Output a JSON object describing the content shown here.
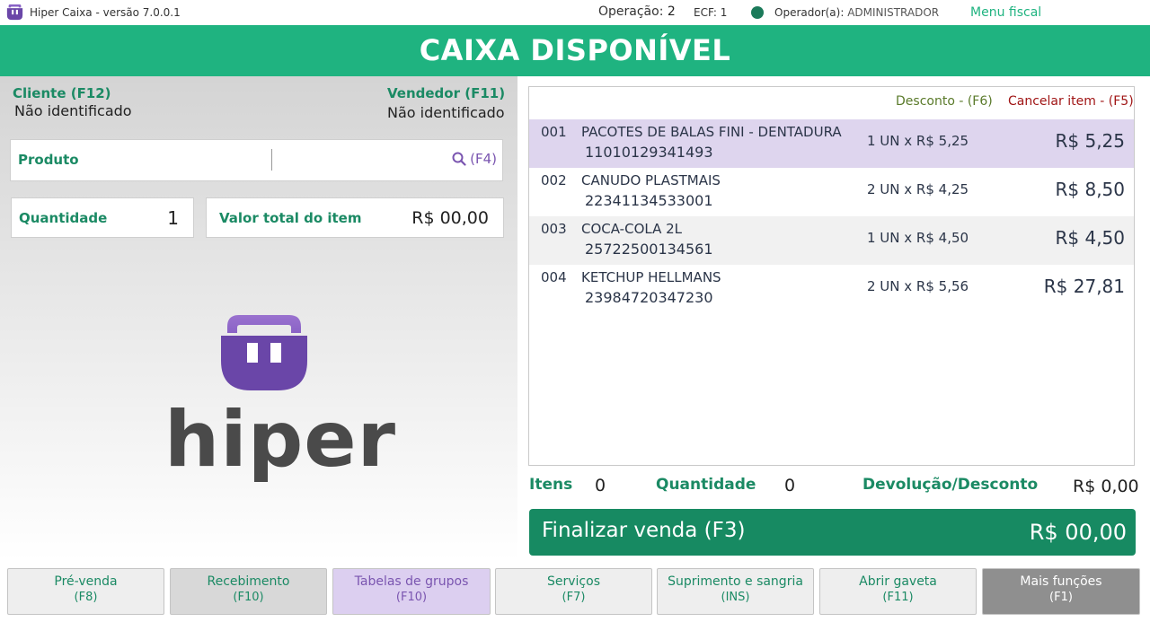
{
  "titlebar": {
    "app_title": "Hiper Caixa - versão 7.0.0.1",
    "operacao_label": "Operação:",
    "operacao_value": "2",
    "ecf": "ECF: 1",
    "operador_label": "Operador(a):",
    "operador_name": "ADMINISTRADOR",
    "menu_fiscal": "Menu fiscal",
    "status_color": "#1b7a5a"
  },
  "header": {
    "title": "CAIXA DISPONÍVEL",
    "color": "#1fb380"
  },
  "left": {
    "cliente_label": "Cliente (F12)",
    "cliente_value": "Não identificado",
    "vendedor_label": "Vendedor (F11)",
    "vendedor_value": "Não identificado",
    "produto_label": "Produto",
    "produto_value": "",
    "search_shortcut": "(F4)",
    "quantidade_label": "Quantidade",
    "quantidade_value": "1",
    "valor_label": "Valor total do item",
    "valor_value": "R$ 00,00",
    "brand_word": "hiper"
  },
  "items": {
    "desconto_label": "Desconto - (F6)",
    "cancelar_label": "Cancelar item - (F5)",
    "rows": [
      {
        "num": "001",
        "name": "PACOTES DE BALAS FINI - DENTADURA",
        "code": "11010129341493",
        "qty": "1 UN x R$ 5,25",
        "total": "R$ 5,25"
      },
      {
        "num": "002",
        "name": "CANUDO PLASTMAIS",
        "code": "22341134533001",
        "qty": "2 UN x R$ 4,25",
        "total": "R$ 8,50"
      },
      {
        "num": "003",
        "name": "COCA-COLA 2L",
        "code": "25722500134561",
        "qty": "1 UN x R$ 4,50",
        "total": "R$ 4,50"
      },
      {
        "num": "004",
        "name": "KETCHUP HELLMANS",
        "code": "23984720347230",
        "qty": "2 UN x R$ 5,56",
        "total": "R$ 27,81"
      }
    ]
  },
  "summary": {
    "itens_label": "Itens",
    "itens_value": "0",
    "quantidade_label": "Quantidade",
    "quantidade_value": "0",
    "devolucao_label": "Devolução/Desconto",
    "devolucao_value": "R$ 0,00"
  },
  "finalizar": {
    "label": "Finalizar venda (F3)",
    "total": "R$ 00,00"
  },
  "function_buttons": [
    {
      "label": "Pré-venda",
      "key": "(F8)"
    },
    {
      "label": "Recebimento",
      "key": "(F10)"
    },
    {
      "label": "Tabelas de grupos",
      "key": "(F10)"
    },
    {
      "label": "Serviços",
      "key": "(F7)"
    },
    {
      "label": "Suprimento e sangria",
      "key": "(INS)"
    },
    {
      "label": "Abrir gaveta",
      "key": "(F11)"
    },
    {
      "label": "Mais funções",
      "key": "(F1)"
    }
  ]
}
